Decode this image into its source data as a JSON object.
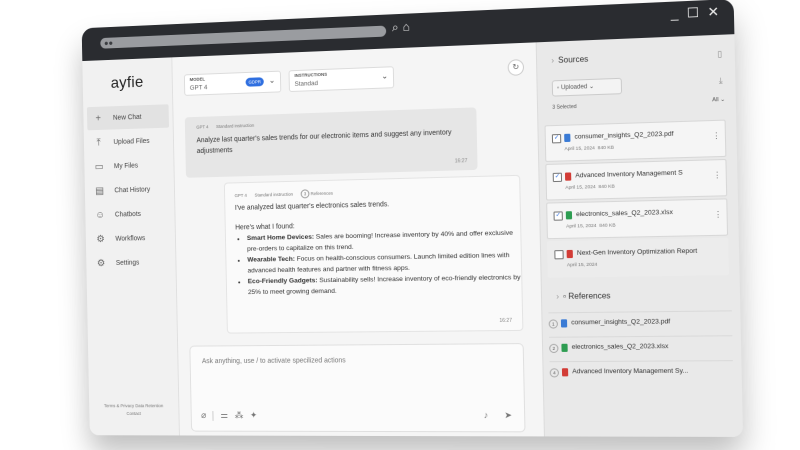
{
  "window": {
    "controls": [
      "_",
      "☐",
      "✕"
    ]
  },
  "sidebar": {
    "logo": "ayfie",
    "items": [
      {
        "icon": "plus-icon",
        "glyph": "+",
        "label": "New Chat",
        "active": true
      },
      {
        "icon": "upload-icon",
        "glyph": "⤒",
        "label": "Upload Files"
      },
      {
        "icon": "folder-icon",
        "glyph": "▭",
        "label": "My Files"
      },
      {
        "icon": "history-icon",
        "glyph": "▤",
        "label": "Chat History"
      },
      {
        "icon": "chatbot-icon",
        "glyph": "☺",
        "label": "Chatbots"
      },
      {
        "icon": "workflow-icon",
        "glyph": "⚙",
        "label": "Workflows"
      },
      {
        "icon": "settings-icon",
        "glyph": "⚙",
        "label": "Settings"
      }
    ],
    "footer_links": "Terms & Privacy   Data Retention",
    "footer_contact": "Contact"
  },
  "model": {
    "label": "MODEL",
    "value": "GPT 4",
    "badge": "GDPR"
  },
  "instructions": {
    "label": "INSTRUCTIONS",
    "value": "Standad"
  },
  "user_message": {
    "model": "GPT 4",
    "instruction": "Standard instruction",
    "text": "Analyze last quarter's sales trends for our electronic items and suggest any inventory adjustments",
    "time": "16:27"
  },
  "ai_message": {
    "model": "GPT 4",
    "instruction": "Standard instruction",
    "ref_count": "3",
    "ref_label": "References",
    "intro": "I've analyzed last quarter's electronics sales trends.",
    "found": "Here's what I found:",
    "bullets": [
      {
        "title": "Smart Home Devices:",
        "text": " Sales are booming! Increase inventory by 40% and offer exclusive pre-orders to capitalize on this trend."
      },
      {
        "title": "Wearable Tech:",
        "text": " Focus on health-conscious consumers. Launch limited edition lines with advanced health features and partner with fitness apps."
      },
      {
        "title": "Eco-Friendly Gadgets:",
        "text": " Sustainability sells! Increase inventory of eco-friendly electronics by 25% to meet growing demand."
      }
    ],
    "time": "16:27"
  },
  "composer": {
    "placeholder": "Ask anything, use / to activate specilized actions"
  },
  "sources": {
    "title": "Sources",
    "filter": "Uploaded",
    "selected": "3 Selected",
    "all": "All",
    "files": [
      {
        "name": "consumer_insights_Q2_2023.pdf",
        "date": "April 15, 2024",
        "size": "840 KB",
        "type": "pdf",
        "checked": true
      },
      {
        "name": "Advanced Inventory Management S",
        "date": "April 15, 2024",
        "size": "840 KB",
        "type": "red",
        "checked": true
      },
      {
        "name": "electronics_sales_Q2_2023.xlsx",
        "date": "April 15, 2024",
        "size": "840 KB",
        "type": "xls",
        "checked": true
      },
      {
        "name": "Next-Gen Inventory Optimization Report",
        "date": "April 15, 2024",
        "size": "",
        "type": "red",
        "checked": false
      }
    ]
  },
  "references": {
    "title": "References",
    "items": [
      {
        "num": "1",
        "name": "consumer_insights_Q2_2023.pdf",
        "type": "pdf"
      },
      {
        "num": "2",
        "name": "electronics_sales_Q2_2023.xlsx",
        "type": "xls"
      },
      {
        "num": "4",
        "name": "Advanced Inventory Management Sy...",
        "type": "red"
      }
    ]
  }
}
